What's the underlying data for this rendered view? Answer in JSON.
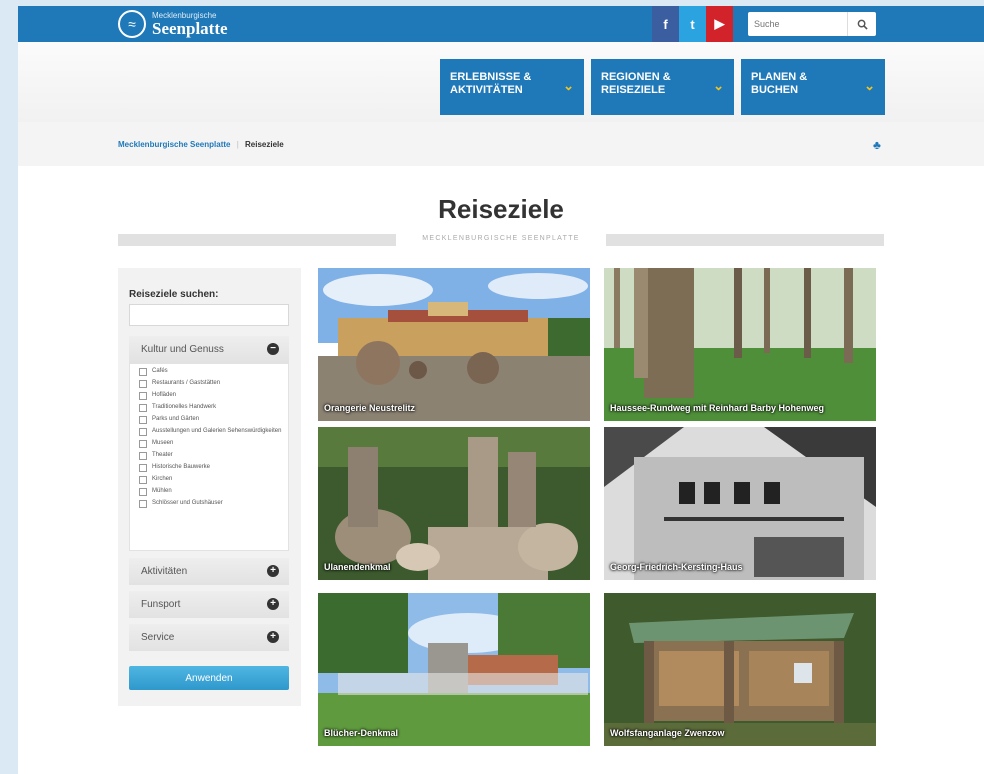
{
  "header": {
    "logo_small": "Mecklenburgische",
    "logo_big": "Seenplatte",
    "social": {
      "facebook": "f",
      "twitter": "t",
      "youtube": "▶"
    },
    "search_placeholder": "Suche"
  },
  "nav": [
    {
      "line1": "ERLEBNISSE &",
      "line2": "AKTIVITÄTEN"
    },
    {
      "line1": "REGIONEN &",
      "line2": "REISEZIELE"
    },
    {
      "line1": "PLANEN &",
      "line2": "BUCHEN"
    }
  ],
  "breadcrumb": {
    "home": "Mecklenburgische Seenplatte",
    "current": "Reiseziele"
  },
  "page": {
    "title": "Reiseziele",
    "subtitle": "MECKLENBURGISCHE SEENPLATTE"
  },
  "sidebar": {
    "search_label": "Reiseziele suchen:",
    "sections": [
      {
        "label": "Kultur und Genuss",
        "icon": "minus-circle-icon"
      },
      {
        "label": "Aktivitäten",
        "icon": "plus-circle-icon"
      },
      {
        "label": "Funsport",
        "icon": "plus-circle-icon"
      },
      {
        "label": "Service",
        "icon": "plus-circle-icon"
      }
    ],
    "checklist": [
      "Cafés",
      "Restaurants / Gaststätten",
      "Hofläden",
      "Traditionelles Handwerk",
      "Parks und Gärten",
      "Ausstellungen und Galerien Sehenswürdigkeiten",
      "Museen",
      "Theater",
      "Historische Bauwerke",
      "Kirchen",
      "Mühlen",
      "Schlösser und Gutshäuser"
    ],
    "apply_label": "Anwenden"
  },
  "tiles": [
    "Orangerie Neustrelitz",
    "Haussee-Rundweg mit Reinhard Barby Hohenweg",
    "Ulanendenkmal",
    "Georg-Friedrich-Kersting-Haus",
    "Blücher-Denkmal",
    "Wolfsfanganlage Zwenzow"
  ],
  "colors": {
    "primary": "#1f79b9",
    "accent": "#f3c51a",
    "button": "#3aa6d8"
  }
}
